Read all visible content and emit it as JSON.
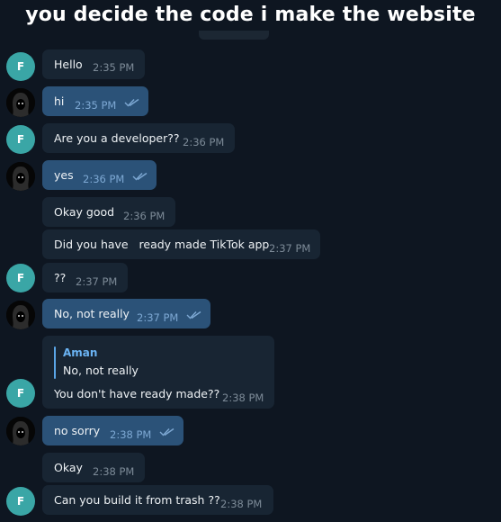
{
  "meme_caption": "you decide the code i make the website",
  "avatar_initial": "F",
  "messages": [
    {
      "text": "Hello",
      "time": "2:35 PM"
    },
    {
      "text": "hi",
      "time": "2:35 PM"
    },
    {
      "text": "Are you a developer??",
      "time": "2:36 PM"
    },
    {
      "text": "yes",
      "time": "2:36 PM"
    },
    {
      "text": "Okay good",
      "time": "2:36 PM"
    },
    {
      "text": "Did you have   ready made TikTok app",
      "time": "2:37 PM"
    },
    {
      "text": "??",
      "time": "2:37 PM"
    },
    {
      "text": "No, not really",
      "time": "2:37 PM"
    },
    {
      "text": "You don't have ready made??",
      "time": "2:38 PM",
      "reply_author": "Aman",
      "reply_text": "No, not really"
    },
    {
      "text": "no sorry",
      "time": "2:38 PM"
    },
    {
      "text": "Okay",
      "time": "2:38 PM"
    },
    {
      "text": "Can you build it from trash ??",
      "time": "2:38 PM"
    }
  ],
  "colors": {
    "background": "#0e1621",
    "incoming_bubble": "#182533",
    "outgoing_bubble": "#2b5278",
    "avatar_f": "#3aa6a6",
    "read_check": "#7da8d3"
  }
}
